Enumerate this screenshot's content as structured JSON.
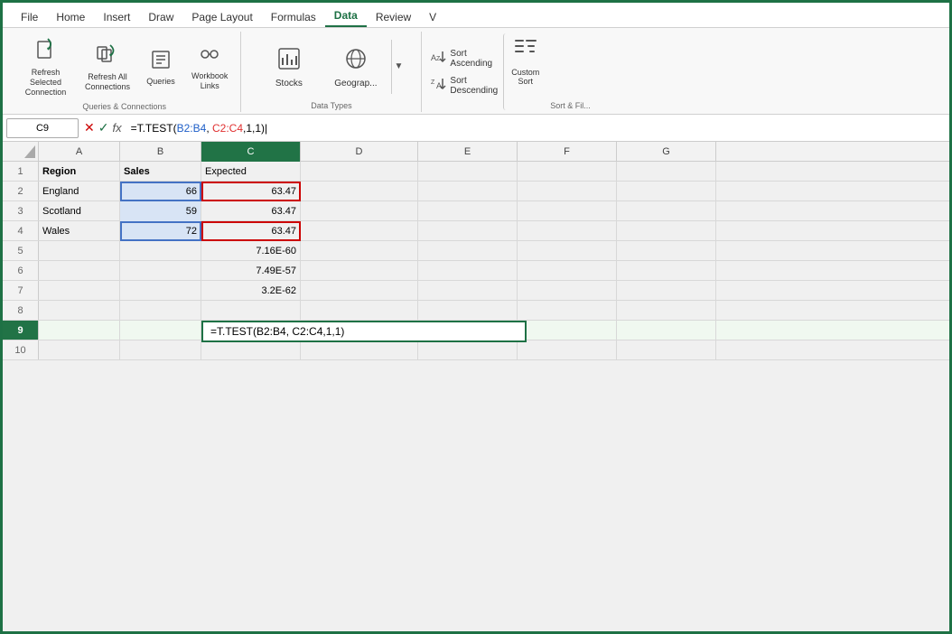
{
  "menu": {
    "items": [
      "File",
      "Home",
      "Insert",
      "Draw",
      "Page Layout",
      "Formulas",
      "Data",
      "Review",
      "V"
    ]
  },
  "ribbon": {
    "group_qc": {
      "label": "Queries & Connections",
      "btn_refresh_selected_label": "Refresh Selected\nConnection",
      "btn_refresh_all_label": "Refresh All\nConnections",
      "btn_queries_label": "Queries",
      "btn_workbook_links_label": "Workbook\nLinks"
    },
    "group_datatypes": {
      "label": "Data Types",
      "btn_stocks_label": "Stocks",
      "btn_geography_label": "Geograp..."
    },
    "group_sortfilter": {
      "label": "Sort & Fil...",
      "sort_ascending_label": "Sort Ascending",
      "sort_descending_label": "Sort Descending",
      "custom_sort_label": "Custom\nSort"
    }
  },
  "formula_bar": {
    "cell_ref": "C9",
    "formula": "=T.TEST(B2:B4, C2:C4,1,1)"
  },
  "columns": [
    "A",
    "B",
    "C",
    "D",
    "E",
    "F",
    "G"
  ],
  "rows": [
    {
      "num": 1,
      "cells": [
        "Region",
        "Sales",
        "Expected",
        "",
        "",
        "",
        ""
      ]
    },
    {
      "num": 2,
      "cells": [
        "England",
        "66",
        "63.47",
        "",
        "",
        "",
        ""
      ]
    },
    {
      "num": 3,
      "cells": [
        "Scotland",
        "59",
        "63.47",
        "",
        "",
        "",
        ""
      ]
    },
    {
      "num": 4,
      "cells": [
        "Wales",
        "72",
        "63.47",
        "",
        "",
        "",
        ""
      ]
    },
    {
      "num": 5,
      "cells": [
        "",
        "",
        "7.16E-60",
        "",
        "",
        "",
        ""
      ]
    },
    {
      "num": 6,
      "cells": [
        "",
        "",
        "7.49E-57",
        "",
        "",
        "",
        ""
      ]
    },
    {
      "num": 7,
      "cells": [
        "",
        "",
        "3.2E-62",
        "",
        "",
        "",
        ""
      ]
    },
    {
      "num": 8,
      "cells": [
        "",
        "",
        "",
        "",
        "",
        "",
        ""
      ]
    },
    {
      "num": 9,
      "cells": [
        "",
        "",
        "=T.TEST(B2:B4, C2:C4,1,1)",
        "",
        "",
        "",
        ""
      ]
    },
    {
      "num": 10,
      "cells": [
        "",
        "",
        "",
        "",
        "",
        "",
        ""
      ]
    }
  ]
}
